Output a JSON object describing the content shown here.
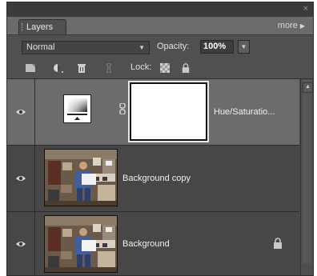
{
  "window": {
    "close_glyph": "×"
  },
  "panel": {
    "tab_title": "Layers",
    "more_label": "more"
  },
  "controls": {
    "blend_mode": "Normal",
    "opacity_label": "Opacity:",
    "opacity_value": "100%",
    "lock_label": "Lock:"
  },
  "layers": [
    {
      "name": "Hue/Saturatio...",
      "type": "adjustment",
      "selected": true,
      "visible": true,
      "locked": false
    },
    {
      "name": "Background copy",
      "type": "image",
      "selected": false,
      "visible": true,
      "locked": false
    },
    {
      "name": "Background",
      "type": "image",
      "selected": false,
      "visible": true,
      "locked": true
    }
  ],
  "icons": {
    "tools": [
      "new-layer-icon",
      "adjustment-layer-icon",
      "trash-icon",
      "link-icon"
    ],
    "lock": [
      "lock-transparency-icon",
      "lock-all-icon"
    ],
    "layer": [
      "eye-icon",
      "lock-icon",
      "chain-link-icon"
    ]
  },
  "colors": {
    "panel_bg": "#4a4a4a",
    "selected_row": "#6c6c6c",
    "row_bg": "#474747"
  }
}
